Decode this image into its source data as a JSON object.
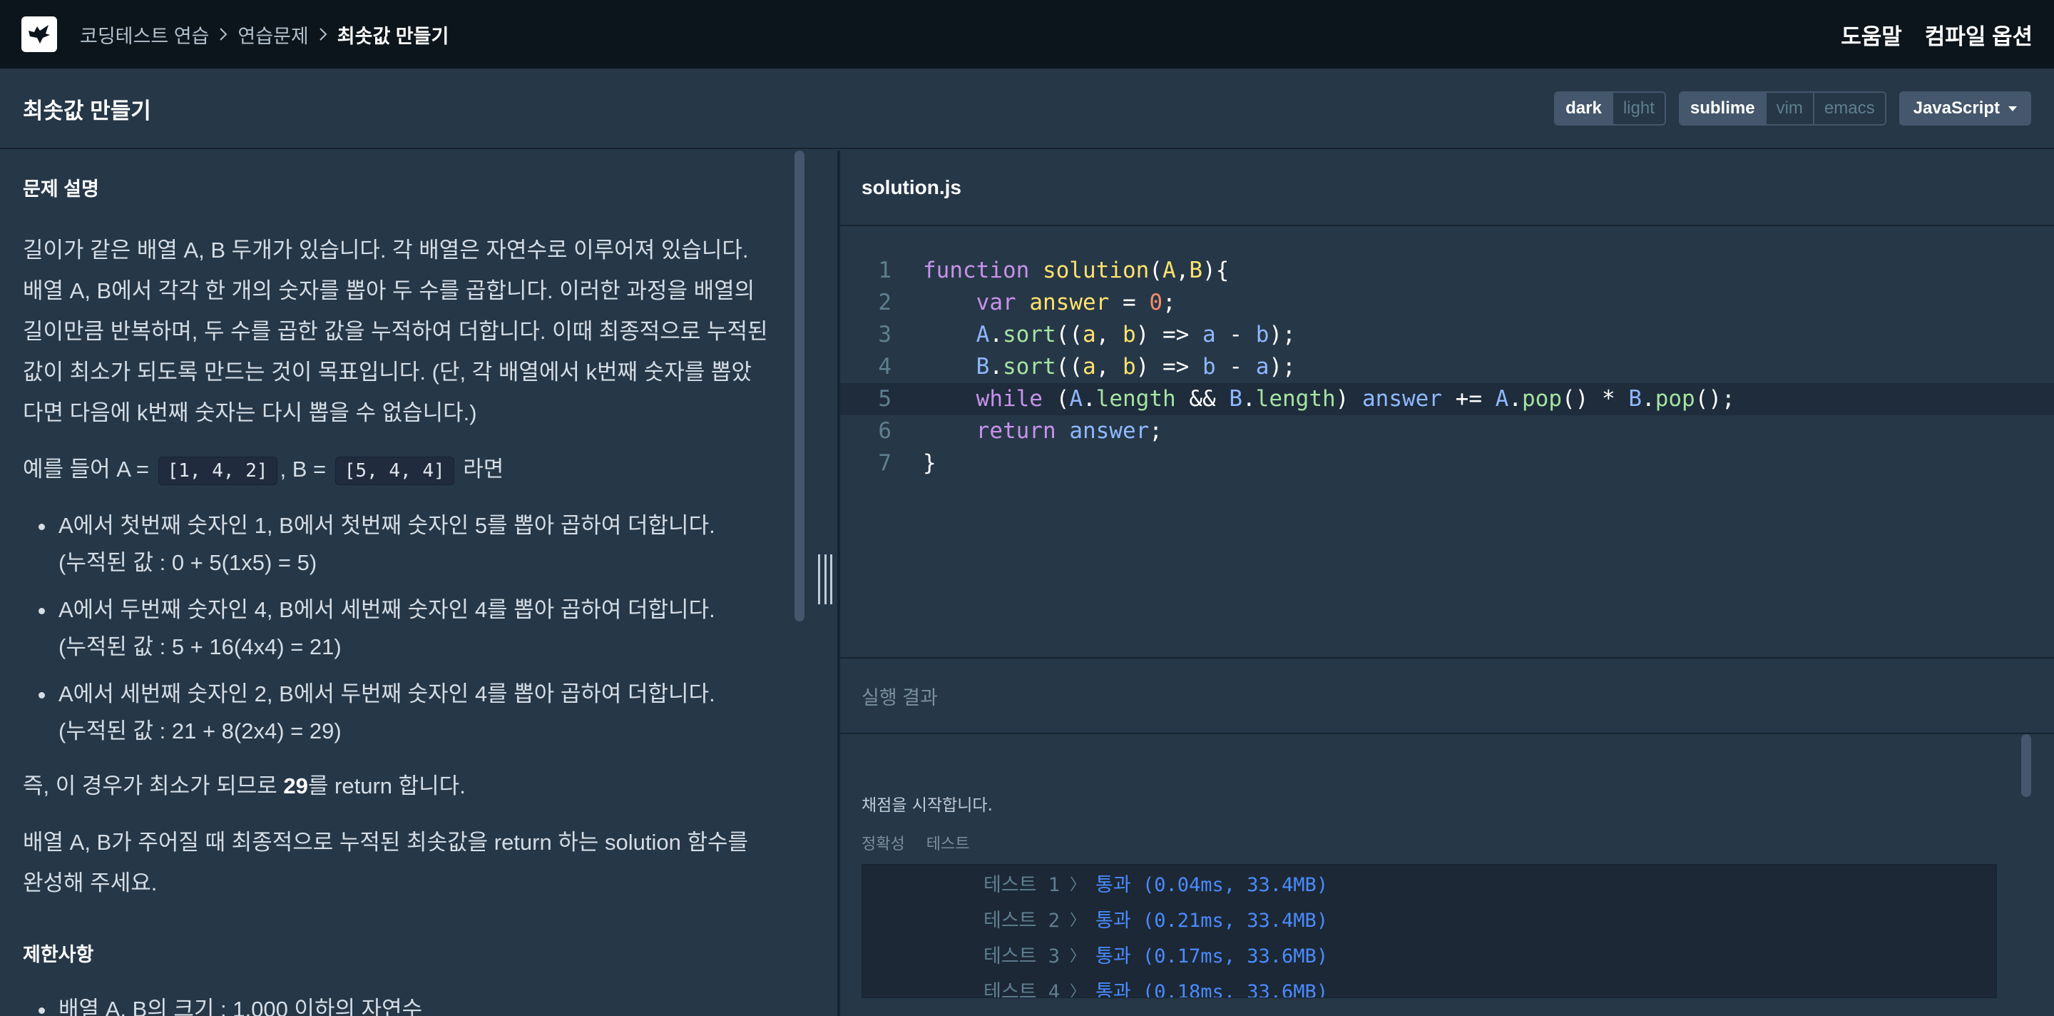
{
  "breadcrumb": {
    "items": [
      "코딩테스트 연습",
      "연습문제",
      "최솟값 만들기"
    ]
  },
  "nav": {
    "help": "도움말",
    "compile_options": "컴파일 옵션"
  },
  "page_title": "최솟값 만들기",
  "theme_toggle": {
    "dark": "dark",
    "light": "light",
    "selected": "dark"
  },
  "keymap_toggle": {
    "sublime": "sublime",
    "vim": "vim",
    "emacs": "emacs",
    "selected": "sublime"
  },
  "language": {
    "selected": "JavaScript"
  },
  "problem": {
    "heading": "문제 설명",
    "intro": "길이가 같은 배열 A, B 두개가 있습니다. 각 배열은 자연수로 이루어져 있습니다. 배열 A, B에서 각각 한 개의 숫자를 뽑아 두 수를 곱합니다. 이러한 과정을 배열의 길이만큼 반복하며, 두 수를 곱한 값을 누적하여 더합니다. 이때 최종적으로 누적된 값이 최소가 되도록 만드는 것이 목표입니다. (단, 각 배열에서 k번째 숫자를 뽑았다면 다음에 k번째 숫자는 다시 뽑을 수 없습니다.)",
    "example_prefix": "예를 들어 A =",
    "example_a": "[1, 4, 2]",
    "example_mid": ", B =",
    "example_b": "[5, 4, 4]",
    "example_suffix": "라면",
    "bullets": [
      {
        "line1": "A에서 첫번째 숫자인 1, B에서 첫번째 숫자인 5를 뽑아 곱하여 더합니다.",
        "line2": "(누적된 값 : 0 + 5(1x5) = 5)"
      },
      {
        "line1": "A에서 두번째 숫자인 4, B에서 세번째 숫자인 4를 뽑아 곱하여 더합니다.",
        "line2": "(누적된 값 : 5 + 16(4x4) = 21)"
      },
      {
        "line1": "A에서 세번째 숫자인 2, B에서 두번째 숫자인 4를 뽑아 곱하여 더합니다.",
        "line2": "(누적된 값 : 21 + 8(2x4) = 29)"
      }
    ],
    "conclusion_prefix": "즉, 이 경우가 최소가 되므로",
    "conclusion_value": "29",
    "conclusion_suffix": "를 return 합니다.",
    "task": "배열 A, B가 주어질 때 최종적으로 누적된 최솟값을 return 하는 solution 함수를 완성해 주세요.",
    "constraints_heading": "제한사항",
    "constraints_first": "배열 A, B의 크기 : 1,000 이하의 자연수"
  },
  "editor": {
    "filename": "solution.js",
    "line_numbers": [
      "1",
      "2",
      "3",
      "4",
      "5",
      "6",
      "7"
    ]
  },
  "result": {
    "heading": "실행 결과",
    "status": "채점을 시작합니다.",
    "tabs": [
      "정확성",
      "테스트"
    ],
    "tests": [
      {
        "label": "테스트 1",
        "result": "통과 (0.04ms, 33.4MB)"
      },
      {
        "label": "테스트 2",
        "result": "통과 (0.21ms, 33.4MB)"
      },
      {
        "label": "테스트 3",
        "result": "통과 (0.17ms, 33.6MB)"
      },
      {
        "label": "테스트 4",
        "result": "통과 (0.18ms, 33.6MB)"
      }
    ]
  },
  "colors": {
    "topbar_bg": "#0c151c",
    "panel_bg": "#263747",
    "pass_text": "#4a8bff",
    "keyword": "#c792ea",
    "function_name": "#ffe26e"
  },
  "icons": [
    "logo-bird-icon",
    "chevron-right-icon",
    "caret-down-icon",
    "vertical-resize-handle-icon",
    "horizontal-resize-handle-icon"
  ]
}
